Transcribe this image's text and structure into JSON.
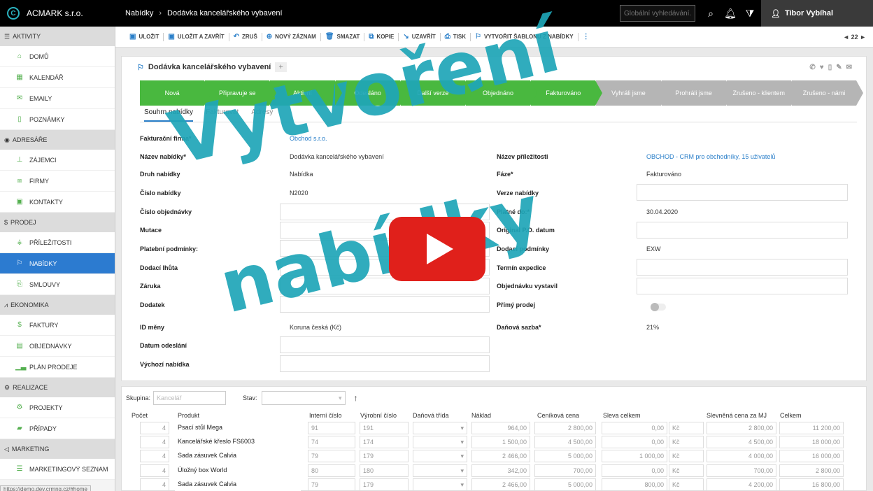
{
  "app": {
    "name": "ACMARK s.r.o."
  },
  "breadcrumb": [
    "Nabídky",
    "Dodávka kancelářského vybavení"
  ],
  "search": {
    "placeholder": "Globální vyhledávání..."
  },
  "user": {
    "name": "Tibor Vybíhal"
  },
  "toolbar": {
    "buttons": [
      "ULOŽIT",
      "ULOŽIT A ZAVŘÍT",
      "ZRUŠ",
      "NOVÝ ZÁZNAM",
      "SMAZAT",
      "KOPIE",
      "UZAVŘÍT",
      "TISK",
      "VYTVOŘIT ŠABLONU Z NABÍDKY"
    ],
    "pager": "◄ 22 ►"
  },
  "sidebar": {
    "sections": [
      {
        "label": "AKTIVITY",
        "items": [
          "DOMŮ",
          "KALENDÁŘ",
          "EMAILY",
          "POZNÁMKY"
        ]
      },
      {
        "label": "ADRESÁŘE",
        "items": [
          "ZÁJEMCI",
          "FIRMY",
          "KONTAKTY"
        ]
      },
      {
        "label": "PRODEJ",
        "items": [
          "PŘÍLEŽITOSTI",
          "NABÍDKY",
          "SMLOUVY"
        ]
      },
      {
        "label": "EKONOMIKA",
        "items": [
          "FAKTURY",
          "OBJEDNÁVKY",
          "PLÁN PRODEJE"
        ]
      },
      {
        "label": "REALIZACE",
        "items": [
          "PROJEKTY",
          "PŘÍPADY"
        ]
      },
      {
        "label": "MARKETING",
        "items": [
          "MARKETINGOVÝ SEZNAM"
        ]
      }
    ],
    "active": "NABÍDKY"
  },
  "status_url": "https://demo.dev.crmng.cz/#home",
  "record": {
    "title": "Dodávka kancelářského vybavení",
    "pipeline": {
      "done": [
        "Nová",
        "Připravuje se",
        "Aktivní",
        "Odesláno",
        "Další verze",
        "Objednáno",
        "Fakturováno"
      ],
      "todo": [
        "Vyhráli jsme",
        "Prohráli jsme",
        "Zrušeno - klientem",
        "Zrušeno - námi"
      ]
    },
    "tabs": [
      "Souhrn nabídky",
      "Fakturovat",
      "Adresy"
    ],
    "left_fields": {
      "fakturacni_firma": {
        "label": "Fakturační firma*",
        "value": "Obchod s.r.o."
      },
      "nazev_nabidky": {
        "label": "Název nabídky*",
        "value": "Dodávka kancelářského vybavení"
      },
      "druh_nabidky": {
        "label": "Druh nabídky",
        "value": "Nabídka"
      },
      "cislo_nabidky": {
        "label": "Číslo nabídky",
        "value": "N2020"
      },
      "cislo_objednavky": {
        "label": "Číslo objednávky"
      },
      "mutace": {
        "label": "Mutace"
      },
      "platebni_podminky": {
        "label": "Platební podmínky:"
      },
      "dodaci_lhuta": {
        "label": "Dodací lhůta"
      },
      "zaruka": {
        "label": "Záruka"
      },
      "dodatek": {
        "label": "Dodatek"
      },
      "id_meny": {
        "label": "ID měny",
        "value": "Koruna česká (Kč)"
      },
      "datum_odeslani": {
        "label": "Datum odeslání"
      },
      "vychozi_nabidka": {
        "label": "Výchozí nabídka"
      }
    },
    "right_fields": {
      "nazev_prilezitosti": {
        "label": "Název příležitosti",
        "value": "OBCHOD - CRM pro obchodníky, 15 uživatelů"
      },
      "faze": {
        "label": "Fáze*",
        "value": "Fakturováno"
      },
      "verze_nabidky": {
        "label": "Verze nabídky"
      },
      "platne_do": {
        "label": "Platné do:*",
        "value": "30.04.2020"
      },
      "original_po_datum": {
        "label": "Original P.O. datum"
      },
      "dodaci_podminky": {
        "label": "Dodací podmínky",
        "value": "EXW"
      },
      "termin_expedice": {
        "label": "Termín expedice"
      },
      "objednavku_vystavil": {
        "label": "Objednávku vystavil"
      },
      "primy_prodej": {
        "label": "Přímý prodej"
      },
      "danova_sazba": {
        "label": "Daňová sazba*",
        "value": "21%"
      }
    }
  },
  "products": {
    "group_label": "Skupina:",
    "group_value": "Kancelář",
    "state_label": "Stav:",
    "columns": [
      "Počet",
      "Produkt",
      "Interní číslo",
      "Výrobní číslo",
      "Daňová třída",
      "Náklad",
      "Ceníková cena",
      "Sleva celkem",
      "Slevněná cena za MJ",
      "Celkem"
    ],
    "rows": [
      {
        "qty": "4",
        "name": "Psací stůl Mega",
        "internal": "91",
        "mfr": "191",
        "cost": "964,00",
        "list": "2 800,00",
        "discount": "0,00",
        "currency": "Kč",
        "unit": "2 800,00",
        "total": "11 200,00"
      },
      {
        "qty": "4",
        "name": "Kancelářské křeslo FS6003",
        "internal": "74",
        "mfr": "174",
        "cost": "1 500,00",
        "list": "4 500,00",
        "discount": "0,00",
        "currency": "Kč",
        "unit": "4 500,00",
        "total": "18 000,00"
      },
      {
        "qty": "4",
        "name": "Sada zásuvek Calvia",
        "internal": "79",
        "mfr": "179",
        "cost": "2 466,00",
        "list": "5 000,00",
        "discount": "1 000,00",
        "currency": "Kč",
        "unit": "4 000,00",
        "total": "16 000,00"
      },
      {
        "qty": "4",
        "name": "Úložný box World",
        "internal": "80",
        "mfr": "180",
        "cost": "342,00",
        "list": "700,00",
        "discount": "0,00",
        "currency": "Kč",
        "unit": "700,00",
        "total": "2 800,00"
      },
      {
        "qty": "4",
        "name": "Sada zásuvek Calvia",
        "internal": "79",
        "mfr": "179",
        "cost": "2 466,00",
        "list": "5 000,00",
        "discount": "800,00",
        "currency": "Kč",
        "unit": "4 200,00",
        "total": "16 800,00"
      }
    ]
  },
  "overlay": {
    "line1": "Vytvoření",
    "line2": "nabídky"
  },
  "colors": {
    "accent": "#2a7fc9",
    "pipeline_done": "#49b83f",
    "pipeline_todo": "#b5b5b5",
    "overlay": "#1fa6b8",
    "play": "#e0201b"
  }
}
